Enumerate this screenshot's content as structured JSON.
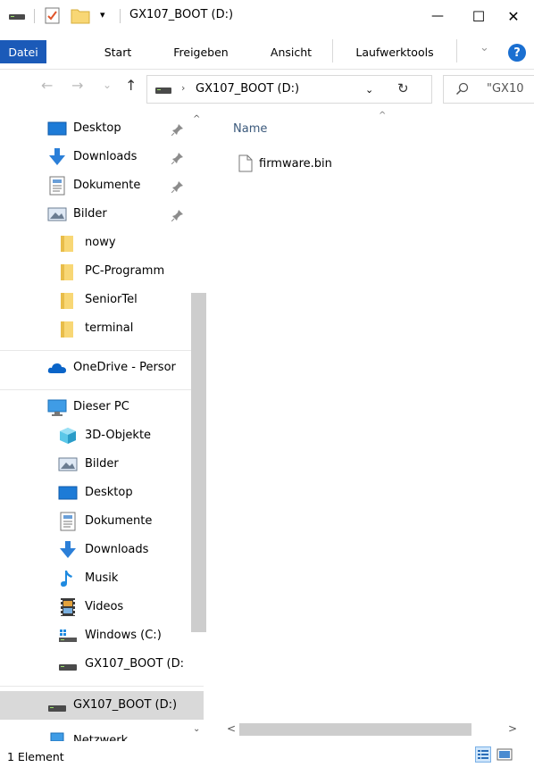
{
  "window": {
    "title": "GX107_BOOT (D:)",
    "minimize_glyph": "—",
    "maximize_glyph": "☐",
    "close_glyph": "✕",
    "quick_access_dropdown_glyph": "▾"
  },
  "ribbon": {
    "tabs": [
      {
        "label": "Datei"
      },
      {
        "label": "Start"
      },
      {
        "label": "Freigeben"
      },
      {
        "label": "Ansicht"
      },
      {
        "label": "Laufwerktools"
      }
    ],
    "collapse_glyph": "⌄",
    "help_glyph": "?"
  },
  "address": {
    "back_glyph": "←",
    "forward_glyph": "→",
    "recent_glyph": "⌄",
    "up_glyph": "↑",
    "separator_glyph": "›",
    "path": "GX107_BOOT (D:)",
    "dropdown_glyph": "⌄",
    "refresh_glyph": "↻",
    "search_text": "\"GX10"
  },
  "nav": {
    "scroll_up_glyph": "^",
    "scroll_down_glyph": "⌄",
    "quick_access": [
      {
        "label": "Desktop",
        "icon": "desktop-icon",
        "pinned": true
      },
      {
        "label": "Downloads",
        "icon": "downloads-icon",
        "pinned": true
      },
      {
        "label": "Dokumente",
        "icon": "documents-icon",
        "pinned": true
      },
      {
        "label": "Bilder",
        "icon": "pictures-icon",
        "pinned": true
      },
      {
        "label": "nowy",
        "icon": "folder-icon"
      },
      {
        "label": "PC-Programm",
        "icon": "folder-icon"
      },
      {
        "label": "SeniorTel",
        "icon": "folder-icon"
      },
      {
        "label": "terminal",
        "icon": "folder-icon"
      }
    ],
    "onedrive": {
      "label": "OneDrive - Persor",
      "icon": "onedrive-icon"
    },
    "this_pc": {
      "label": "Dieser PC",
      "icon": "computer-icon"
    },
    "pc_items": [
      {
        "label": "3D-Objekte",
        "icon": "3d-objects-icon"
      },
      {
        "label": "Bilder",
        "icon": "pictures-icon"
      },
      {
        "label": "Desktop",
        "icon": "desktop-icon"
      },
      {
        "label": "Dokumente",
        "icon": "documents-icon"
      },
      {
        "label": "Downloads",
        "icon": "downloads-icon"
      },
      {
        "label": "Musik",
        "icon": "music-icon"
      },
      {
        "label": "Videos",
        "icon": "videos-icon"
      },
      {
        "label": "Windows (C:)",
        "icon": "windows-drive-icon"
      },
      {
        "label": "GX107_BOOT (D:",
        "icon": "usb-drive-icon"
      }
    ],
    "drive_root": {
      "label": "GX107_BOOT (D:)",
      "icon": "usb-drive-icon"
    },
    "network": {
      "label": "Netzwerk",
      "icon": "network-icon"
    }
  },
  "content": {
    "sort_glyph": "^",
    "column_header": "Name",
    "files": [
      {
        "name": "firmware.bin",
        "icon": "file-icon"
      }
    ],
    "hscroll_left_glyph": "<",
    "hscroll_right_glyph": ">"
  },
  "status": {
    "item_count": "1 Element"
  },
  "colors": {
    "file_tab": "#1b5ab8",
    "folder": "#f8d775",
    "selection": "#d9d9d9",
    "help": "#1a6fd1",
    "onedrive": "#0a64c8",
    "downloads": "#2b7fd8"
  }
}
